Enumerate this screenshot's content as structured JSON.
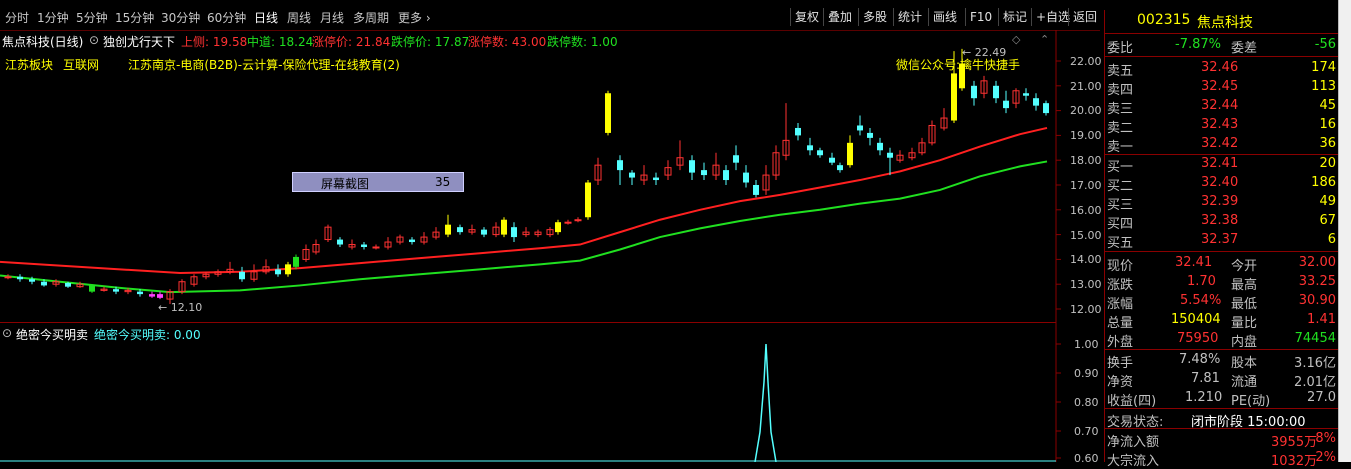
{
  "toolbar": {
    "periods": [
      "分时",
      "1分钟",
      "5分钟",
      "15分钟",
      "30分钟",
      "60分钟",
      "日线",
      "周线",
      "月线",
      "多周期",
      "更多"
    ],
    "buttons": [
      "复权",
      "叠加",
      "多股",
      "统计",
      "画线",
      "F10",
      "标记",
      "+自选",
      "返回"
    ]
  },
  "info": {
    "name": "焦点科技(日线)",
    "indicator": "独创尤行天下",
    "upper_rail": "上侧: 19.58",
    "mid_rail": "中道: 18.24",
    "limit_up": "涨停价: 21.84",
    "limit_down": "跌停价: 17.87",
    "limit_up_count": "涨停数: 43.00",
    "limit_down_count": "跌停数: 1.00"
  },
  "tags": [
    "江苏板块",
    "互联网",
    "江苏南京-电商(B2B)-云计算-保险代理-在线教育(2)"
  ],
  "annotation": "微信公众号:擒牛快捷手",
  "high_marker": "22.49",
  "low_marker": "12.10",
  "screenshot_box": {
    "label": "屏幕截图",
    "value": "35"
  },
  "price_axis": [
    "22.00",
    "21.00",
    "20.00",
    "19.00",
    "18.00",
    "17.00",
    "16.00",
    "15.00",
    "14.00",
    "13.00",
    "12.00"
  ],
  "indicator_panel": {
    "title": "绝密今买明卖",
    "value": "绝密今买明卖: 0.00",
    "axis": [
      "1.00",
      "0.90",
      "0.80",
      "0.70",
      "0.60"
    ]
  },
  "stock": {
    "code": "002315",
    "name": "焦点科技"
  },
  "orderbook": {
    "weibi_label": "委比",
    "weibi": "-7.87%",
    "weicha_label": "委差",
    "weicha": "-56",
    "asks": [
      {
        "label": "卖五",
        "price": "32.46",
        "vol": "174"
      },
      {
        "label": "卖四",
        "price": "32.45",
        "vol": "113"
      },
      {
        "label": "卖三",
        "price": "32.44",
        "vol": "45"
      },
      {
        "label": "卖二",
        "price": "32.43",
        "vol": "16"
      },
      {
        "label": "卖一",
        "price": "32.42",
        "vol": "36"
      }
    ],
    "bids": [
      {
        "label": "买一",
        "price": "32.41",
        "vol": "20"
      },
      {
        "label": "买二",
        "price": "32.40",
        "vol": "186"
      },
      {
        "label": "买三",
        "price": "32.39",
        "vol": "49"
      },
      {
        "label": "买四",
        "price": "32.38",
        "vol": "67"
      },
      {
        "label": "买五",
        "price": "32.37",
        "vol": "6"
      }
    ]
  },
  "quote": [
    {
      "l1": "现价",
      "v1": "32.41",
      "l2": "今开",
      "v2": "32.00"
    },
    {
      "l1": "涨跌",
      "v1": "1.70",
      "l2": "最高",
      "v2": "33.25"
    },
    {
      "l1": "涨幅",
      "v1": "5.54%",
      "l2": "最低",
      "v2": "30.90"
    },
    {
      "l1": "总量",
      "v1": "150404",
      "l2": "量比",
      "v2": "1.41"
    },
    {
      "l1": "外盘",
      "v1": "75950",
      "l2": "内盘",
      "v2": "74454"
    },
    {
      "l1": "换手",
      "v1": "7.48%",
      "l2": "股本",
      "v2": "3.16亿"
    },
    {
      "l1": "净资",
      "v1": "7.81",
      "l2": "流通",
      "v2": "2.01亿"
    },
    {
      "l1": "收益(四)",
      "v1": "1.210",
      "l2": "PE(动)",
      "v2": "27.0"
    }
  ],
  "trade_status": {
    "label": "交易状态:",
    "value": "闭市阶段 15:00:00"
  },
  "flows": [
    {
      "label": "净流入额",
      "value": "3955万",
      "pct": "8%"
    },
    {
      "label": "大宗流入",
      "value": "1032万",
      "pct": "2%"
    }
  ],
  "colors": {
    "up": "#ff3232",
    "down": "#54ffff",
    "yellow": "#ffff00",
    "ma1": "#ff2020",
    "ma2": "#20e020",
    "panel_border": "#8a0000"
  }
}
